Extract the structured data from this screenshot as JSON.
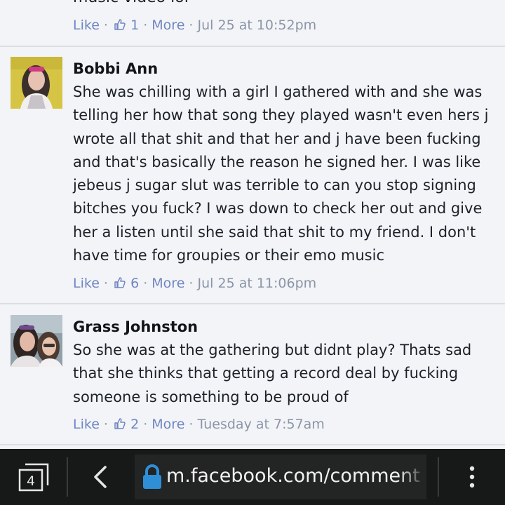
{
  "top_comment": {
    "partial_text": "music video lol",
    "meta": {
      "like": "Like",
      "count": "1",
      "more": "More",
      "time": "Jul 25 at 10:52pm"
    }
  },
  "comments": [
    {
      "author": "Bobbi Ann",
      "text": "She was chilling with a girl I gathered with and she was telling her how that song they played wasn't even hers j wrote all that shit and that her and j have been fucking and that's basically the reason he signed her. I was like jebeus j sugar slut was terrible to can you stop signing bitches you fuck? I was down to check her out and give her a listen until she said that shit to my friend. I don't have time for groupies or their emo music",
      "meta": {
        "like": "Like",
        "count": "6",
        "more": "More",
        "time": "Jul 25 at 11:06pm"
      }
    },
    {
      "author": "Grass Johnston",
      "text": "So she was at the gathering but didnt play? Thats sad that she thinks that getting a record deal by fucking someone is something to be proud of",
      "meta": {
        "like": "Like",
        "count": "2",
        "more": "More",
        "time": "Tuesday at 7:57am"
      }
    }
  ],
  "browser": {
    "tab_count": "4",
    "url": "m.facebook.com/comment",
    "icons": {
      "tabs": "tabs-icon",
      "back": "back-arrow-icon",
      "lock": "lock-icon",
      "menu": "overflow-menu-icon"
    }
  },
  "colors": {
    "feed_background": "#f3f4f7",
    "link": "#6f86c2",
    "toolbar": "#171818",
    "url_bar": "#232424",
    "lock": "#2f8fd6"
  }
}
